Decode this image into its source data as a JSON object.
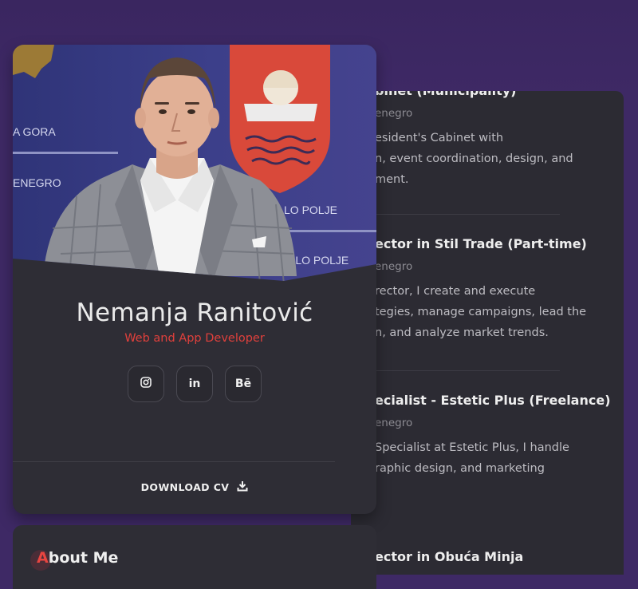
{
  "profile": {
    "name": "Nemanja Ranitović",
    "role": "Web and App Developer",
    "socials": [
      {
        "network": "instagram",
        "icon": "instagram-icon"
      },
      {
        "network": "linkedin",
        "label": "in"
      },
      {
        "network": "behance",
        "label": "Bē"
      }
    ],
    "download_label": "DOWNLOAD CV",
    "download_icon": "download-icon"
  },
  "photo_background": {
    "left_texts": [
      "A GORA",
      "ENEGRO"
    ],
    "right_texts": [
      "LO POLJE",
      "ELO POLJE"
    ]
  },
  "about": {
    "title_first": "A",
    "title_rest": "bout Me"
  },
  "experience": [
    {
      "title": "binet (Municipality)",
      "location": "enegro",
      "desc": [
        "esident's Cabinet with",
        "n, event coordination, design, and",
        "ment."
      ]
    },
    {
      "title": "ector in Stil Trade (Part-time)",
      "location": "enegro",
      "desc": [
        "rector, I create and execute",
        "tegies, manage campaigns, lead the",
        "n, and analyze market trends."
      ]
    },
    {
      "title": "ecialist - Estetic Plus (Freelance)",
      "location": "enegro",
      "desc": [
        " Specialist at Estetic Plus, I handle",
        "raphic design, and marketing"
      ]
    },
    {
      "title": "ector in Obuća Minja",
      "location": "",
      "desc": []
    }
  ],
  "colors": {
    "page_bg": "#3e2965",
    "card_bg": "#2e2d35",
    "accent": "#e0403c",
    "text": "#eaeaea"
  }
}
